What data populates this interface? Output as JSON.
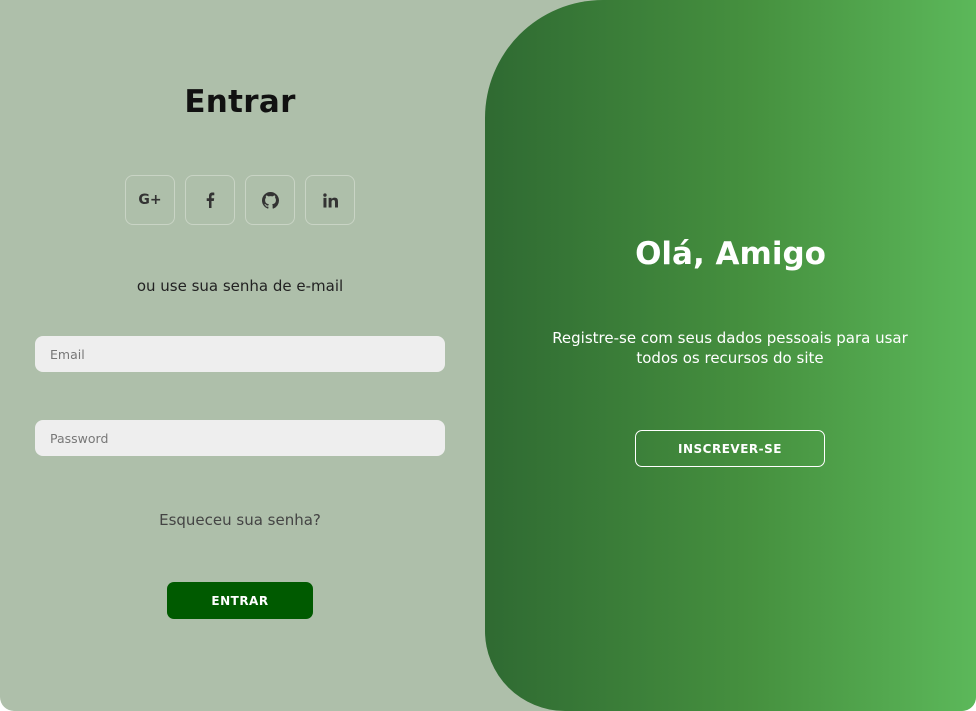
{
  "signin": {
    "title": "Entrar",
    "social": {
      "google_label": "G+",
      "icons": [
        "google-plus-icon",
        "facebook-icon",
        "github-icon",
        "linkedin-icon"
      ]
    },
    "subtitle": "ou use sua senha de e-mail",
    "email_placeholder": "Email",
    "email_value": "",
    "password_placeholder": "Password",
    "password_value": "",
    "forgot_label": "Esqueceu sua senha?",
    "button_label": "ENTRAR"
  },
  "panel": {
    "title": "Olá, Amigo",
    "text": "Registre-se com seus dados pessoais para usar todos os recursos do site",
    "button_label": "INSCREVER-SE"
  },
  "colors": {
    "background": "#aebfaa",
    "signin_button": "#005a00",
    "panel_gradient_start": "#2f6a32",
    "panel_gradient_end": "#5cb85a"
  }
}
